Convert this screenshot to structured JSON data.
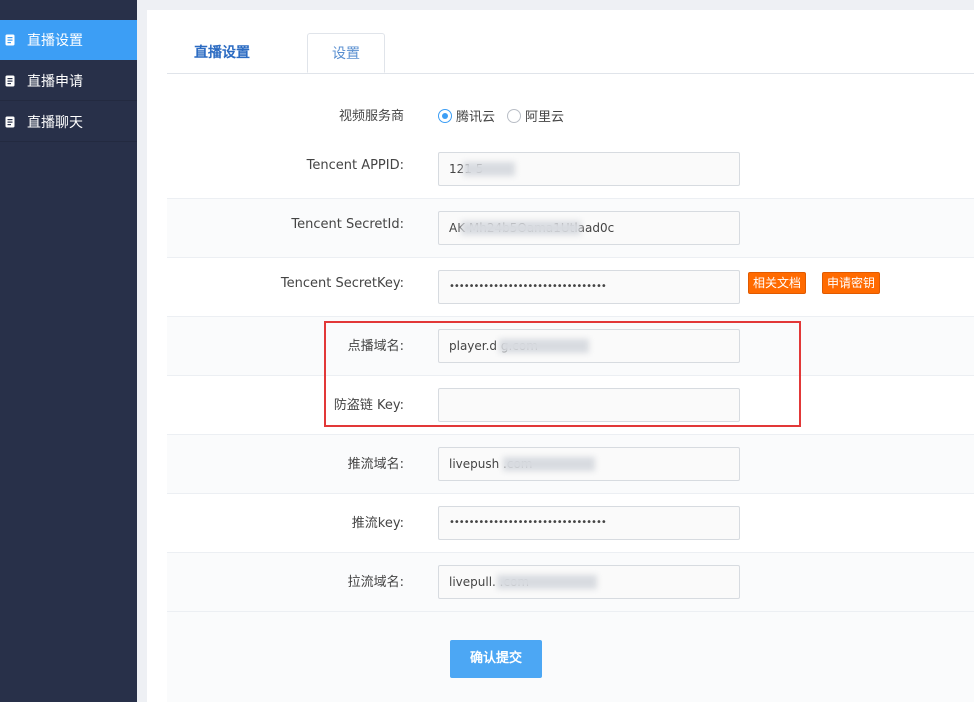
{
  "sidebar": {
    "items": [
      {
        "label": "直播设置",
        "icon": "document-icon",
        "active": true
      },
      {
        "label": "直播申请",
        "icon": "document-icon",
        "active": false
      },
      {
        "label": "直播聊天",
        "icon": "document-icon",
        "active": false
      }
    ]
  },
  "tabs": {
    "main_label": "直播设置",
    "settings_label": "设置"
  },
  "form": {
    "provider": {
      "label": "视频服务商",
      "options": [
        "腾讯云",
        "阿里云"
      ],
      "selected": "腾讯云"
    },
    "appid": {
      "label": "Tencent APPID:",
      "value": "121    5"
    },
    "secret_id": {
      "label": "Tencent SecretId:",
      "value": "AK              Mh24b5Oama1Utlaad0c"
    },
    "secret_key": {
      "label": "Tencent SecretKey:",
      "value": "••••••••••••••••••••••••••••••••"
    },
    "docs_button": "相关文档",
    "apply_key_button": "申请密钥",
    "play_domain": {
      "label": "点播域名:",
      "value": "player.d                g.com"
    },
    "anti_leech_key": {
      "label": "防盗链 Key:",
      "value": ""
    },
    "push_domain": {
      "label": "推流域名:",
      "value": "livepush              .com"
    },
    "push_key": {
      "label": "推流key:",
      "value": "••••••••••••••••••••••••••••••••"
    },
    "pull_domain": {
      "label": "拉流域名:",
      "value": "livepull.              .com"
    },
    "submit_label": "确认提交"
  },
  "colors": {
    "sidebar_bg": "#283049",
    "active_blue": "#3c9ef5",
    "orange": "#ff6a00",
    "highlight_red": "#e23838"
  }
}
